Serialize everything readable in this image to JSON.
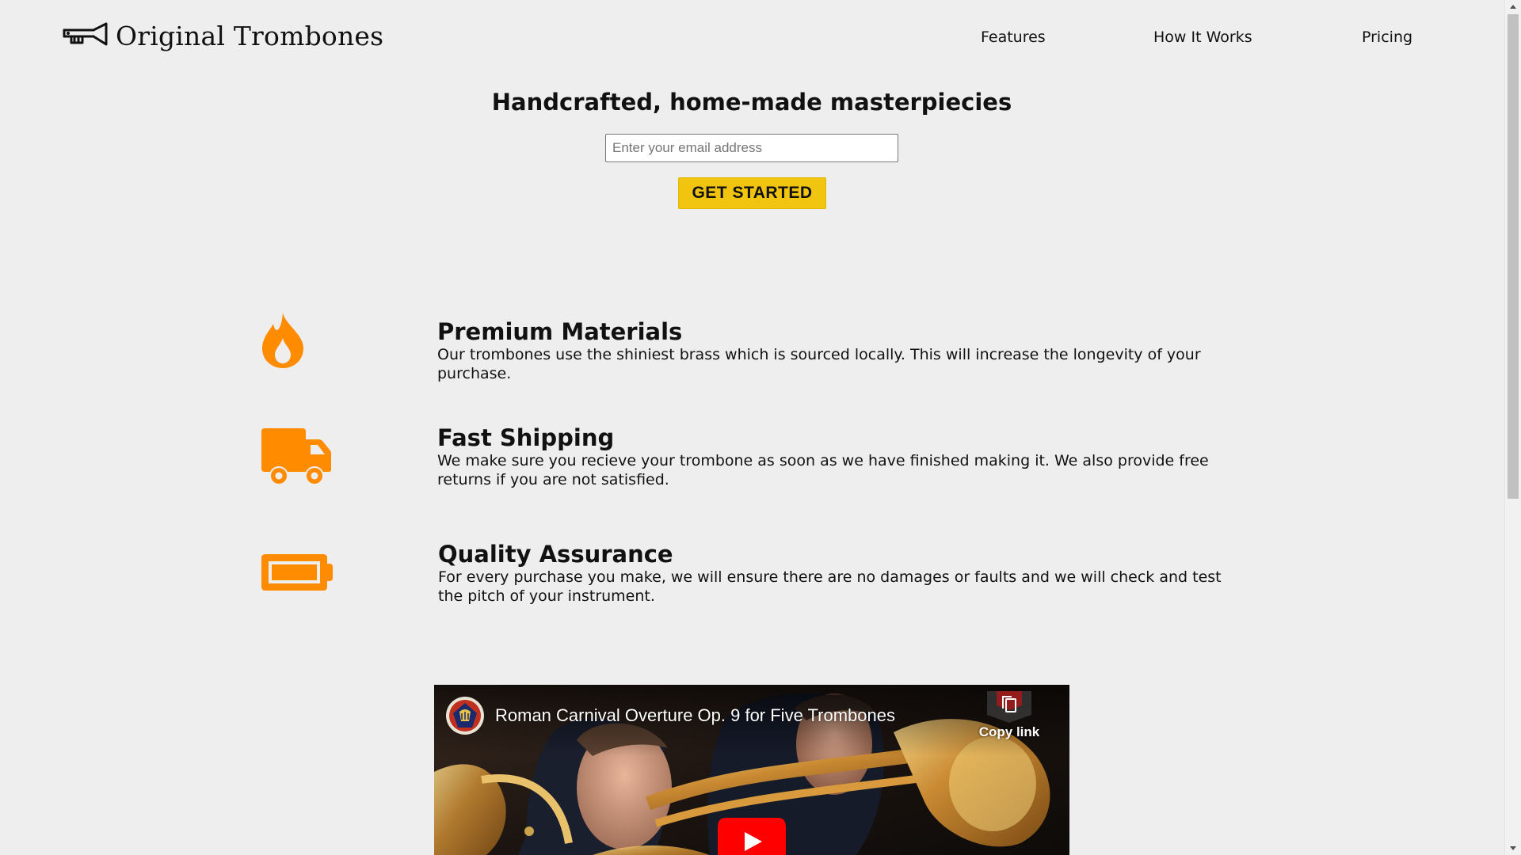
{
  "header": {
    "brand_name": "Original Trombones",
    "nav": [
      {
        "label": "Features"
      },
      {
        "label": "How It Works"
      },
      {
        "label": "Pricing"
      }
    ]
  },
  "hero": {
    "title": "Handcrafted, home-made masterpiecies",
    "email_placeholder": "Enter your email address",
    "email_value": "",
    "cta_label": "GET STARTED"
  },
  "features": [
    {
      "icon": "flame-icon",
      "title": "Premium Materials",
      "description": "Our trombones use the shiniest brass which is sourced locally. This will increase the longevity of your purchase."
    },
    {
      "icon": "truck-icon",
      "title": "Fast Shipping",
      "description": "We make sure you recieve your trombone as soon as we have finished making it. We also provide free returns if you are not satisfied."
    },
    {
      "icon": "battery-icon",
      "title": "Quality Assurance",
      "description": "For every purchase you make, we will ensure there are no damages or faults and we will check and test the pitch of your instrument."
    }
  ],
  "video": {
    "title": "Roman Carnival Overture Op. 9 for Five Trombones",
    "copy_link_label": "Copy link",
    "play_icon": "play-icon"
  },
  "colors": {
    "background": "#eeeeee",
    "accent_orange": "#ff8c00",
    "cta_yellow": "#f1c40f",
    "youtube_red": "#ff0000"
  }
}
